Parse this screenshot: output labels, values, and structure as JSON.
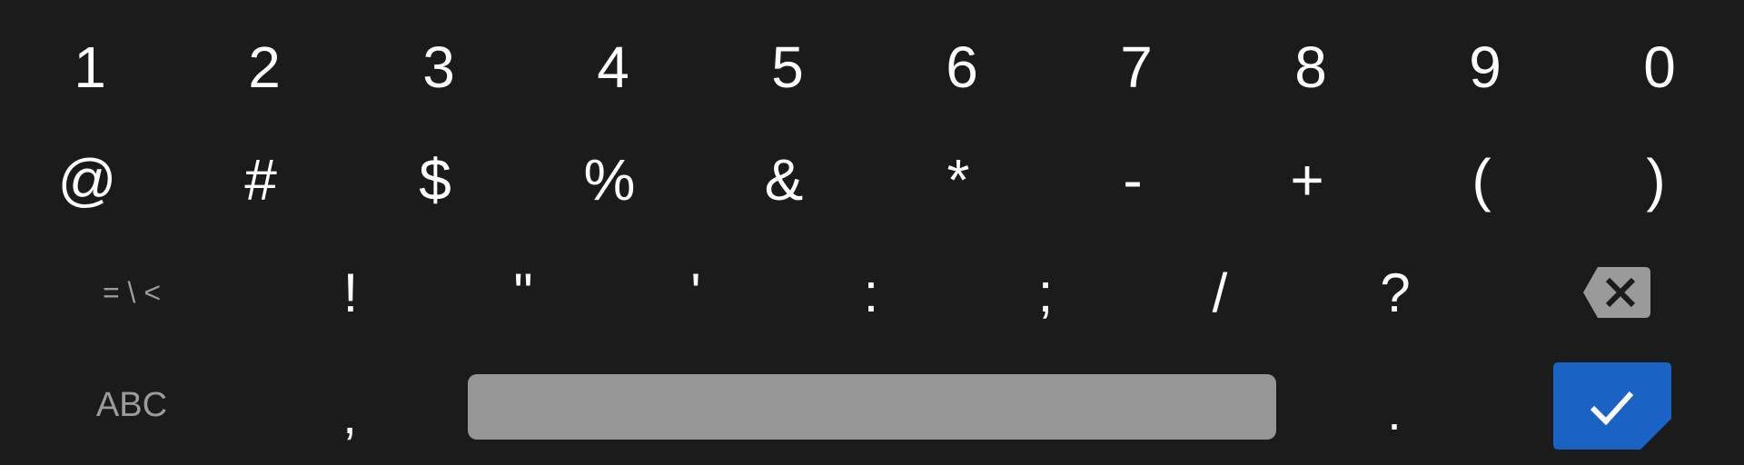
{
  "keyboard": {
    "row1": [
      "1",
      "2",
      "3",
      "4",
      "5",
      "6",
      "7",
      "8",
      "9",
      "0"
    ],
    "row2": [
      "@",
      "#",
      "$",
      "%",
      "&",
      "*",
      "-",
      "+",
      "(",
      ")"
    ],
    "row3": {
      "mode_label": "= \\ <",
      "keys": [
        "!",
        "\"",
        "'",
        ":",
        ";",
        "/",
        "?"
      ],
      "backspace_icon": "backspace-icon"
    },
    "row4": {
      "mode_label": "ABC",
      "comma": ",",
      "period": ".",
      "enter_icon": "checkmark-icon"
    },
    "colors": {
      "background": "#1b1b1b",
      "key_text": "#ffffff",
      "secondary_text": "#9c9c9c",
      "spacebar": "#969696",
      "backspace": "#9a9a9a",
      "enter": "#1a63c4"
    }
  }
}
